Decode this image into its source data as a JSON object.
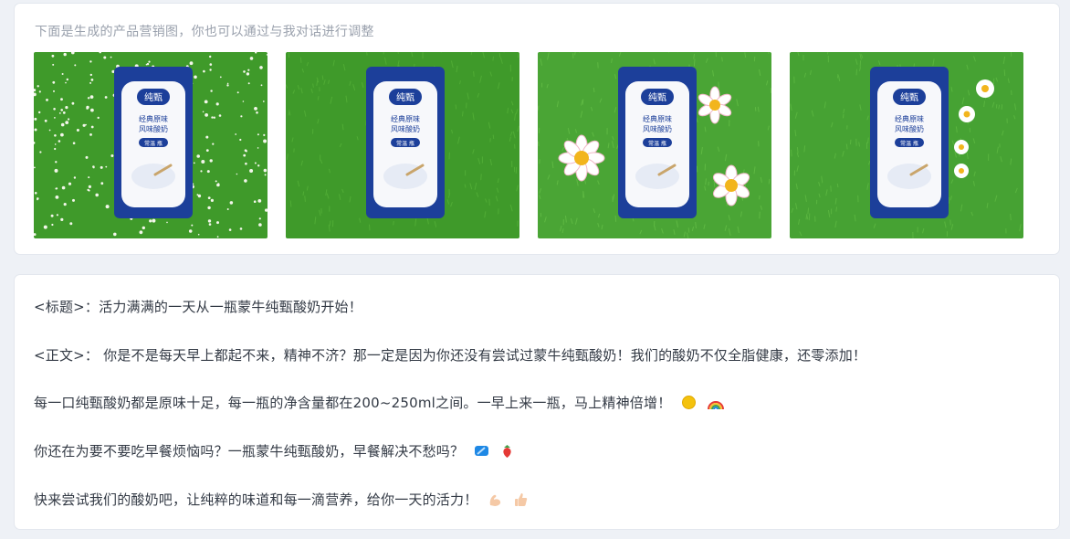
{
  "intro_text": "下面是生成的产品营销图，你也可以通过与我对话进行调整",
  "images": [
    {
      "name": "product-image-grass-dots",
      "scene": "grass with small white flowers",
      "flowers": "tiny-scattered"
    },
    {
      "name": "product-image-grass-plain",
      "scene": "plain grass",
      "flowers": "none"
    },
    {
      "name": "product-image-grass-daisies",
      "scene": "grass with pink daisies",
      "flowers": "daisies"
    },
    {
      "name": "product-image-grass-small-daisies",
      "scene": "grass with small white daisies",
      "flowers": "small-daisies"
    }
  ],
  "product": {
    "brand": "纯甄",
    "line1": "经典原味",
    "line2": "风味酸奶",
    "tag": "常温 瓶"
  },
  "copy": {
    "title_line": "<标题>：活力满满的一天从一瓶蒙牛纯甄酸奶开始！",
    "body_line": "<正文>： 你是不是每天早上都起不来，精神不济？那一定是因为你还没有尝试过蒙牛纯甄酸奶！我们的酸奶不仅全脂健康，还零添加！",
    "para1": "每一口纯甄酸奶都是原味十足，每一瓶的净含量都在200~250ml之间。一早上来一瓶，马上精神倍增！",
    "para2": "你还在为要不要吃早餐烦恼吗？一瓶蒙牛纯甄酸奶，早餐解决不愁吗？",
    "para3": "快来尝试我们的酸奶吧，让纯粹的味道和每一滴营养，给你一天的活力！"
  },
  "emoji": {
    "para1": [
      "sun-emoji",
      "rainbow-emoji"
    ],
    "para2": [
      "droplet-emoji",
      "strawberry-emoji"
    ],
    "para3": [
      "flexed-biceps-emoji",
      "thumbs-up-emoji"
    ]
  },
  "colors": {
    "grass": "#3f9a2a",
    "carton_blue": "#1c3f9a",
    "text": "#333a45",
    "muted": "#9aa1ad"
  }
}
